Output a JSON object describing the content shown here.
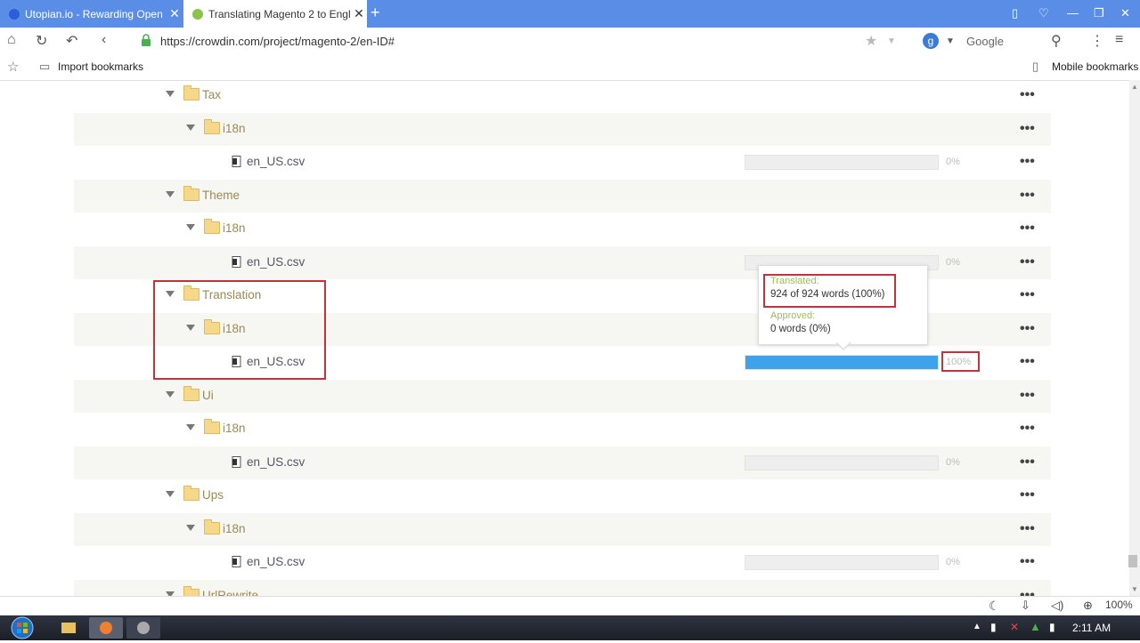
{
  "browser": {
    "tabs": [
      {
        "label": "Utopian.io - Rewarding Open",
        "active": false
      },
      {
        "label": "Translating Magento 2 to Engl",
        "active": true
      }
    ],
    "address": "https://crowdin.com/project/magento-2/en-ID#",
    "search_engine": "Google",
    "bookmarks": {
      "import": "Import bookmarks",
      "mobile": "Mobile bookmarks"
    },
    "zoom": "100%"
  },
  "tree": {
    "rows": [
      {
        "type": "folder",
        "label": "Tax"
      },
      {
        "type": "folder",
        "label": "i18n"
      },
      {
        "type": "file",
        "label": "en_US.csv",
        "percent": "0%",
        "progress": 0
      },
      {
        "type": "folder",
        "label": "Theme"
      },
      {
        "type": "folder",
        "label": "i18n"
      },
      {
        "type": "file",
        "label": "en_US.csv",
        "percent": "0%",
        "progress": 0
      },
      {
        "type": "folder",
        "label": "Translation"
      },
      {
        "type": "folder",
        "label": "i18n"
      },
      {
        "type": "file",
        "label": "en_US.csv",
        "percent": "100%",
        "progress": 1
      },
      {
        "type": "folder",
        "label": "Ui"
      },
      {
        "type": "folder",
        "label": "i18n"
      },
      {
        "type": "file",
        "label": "en_US.csv",
        "percent": "0%",
        "progress": 0
      },
      {
        "type": "folder",
        "label": "Ups"
      },
      {
        "type": "folder",
        "label": "i18n"
      },
      {
        "type": "file",
        "label": "en_US.csv",
        "percent": "0%",
        "progress": 0
      },
      {
        "type": "folder",
        "label": "UrlRewrite"
      }
    ]
  },
  "tooltip": {
    "translated_label": "Translated:",
    "translated_value": "924 of 924 words (100%)",
    "approved_label": "Approved:",
    "approved_value": "0 words (0%)"
  },
  "taskbar": {
    "time": "2:11 AM"
  },
  "colors": {
    "progress": "#3fa3ec",
    "annotation": "#c0323c",
    "tab_strip": "#5a8ee6"
  }
}
